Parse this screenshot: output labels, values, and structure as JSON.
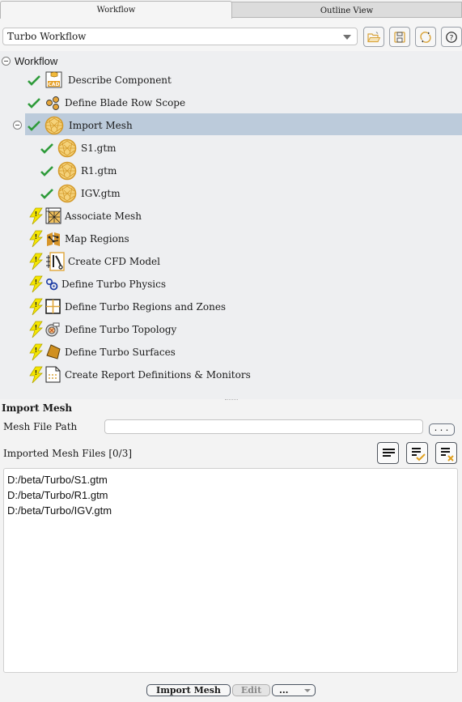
{
  "tabs": [
    {
      "label": "Workflow",
      "active": true
    },
    {
      "label": "Outline View",
      "active": false
    }
  ],
  "toolbar": {
    "workflow_select": "Turbo Workflow",
    "buttons": [
      {
        "icon": "folder-open-icon",
        "tooltip": "Open"
      },
      {
        "icon": "save-icon",
        "tooltip": "Save"
      },
      {
        "icon": "refresh-icon",
        "tooltip": "Refresh"
      },
      {
        "icon": "help-icon",
        "tooltip": "Help"
      }
    ]
  },
  "tree": {
    "root": "Workflow",
    "items": [
      {
        "label": "Describe Component",
        "status": "done",
        "icon": "cad-icon"
      },
      {
        "label": "Define Blade Row Scope",
        "status": "done",
        "icon": "blade-row-icon"
      },
      {
        "label": "Import Mesh",
        "status": "done",
        "icon": "mesh-sphere-icon",
        "selected": true,
        "expanded": true,
        "children": [
          {
            "label": "S1.gtm",
            "status": "done",
            "icon": "mesh-sphere-icon"
          },
          {
            "label": "R1.gtm",
            "status": "done",
            "icon": "mesh-sphere-icon"
          },
          {
            "label": "IGV.gtm",
            "status": "done",
            "icon": "mesh-sphere-icon"
          }
        ]
      },
      {
        "label": "Associate Mesh",
        "status": "pending",
        "icon": "associate-mesh-icon"
      },
      {
        "label": "Map Regions",
        "status": "pending",
        "icon": "map-regions-icon"
      },
      {
        "label": "Create CFD Model",
        "status": "pending",
        "icon": "cfd-model-icon"
      },
      {
        "label": "Define Turbo Physics",
        "status": "pending",
        "icon": "physics-icon"
      },
      {
        "label": "Define Turbo Regions and Zones",
        "status": "pending",
        "icon": "regions-zones-icon"
      },
      {
        "label": "Define Turbo Topology",
        "status": "pending",
        "icon": "topology-icon"
      },
      {
        "label": "Define Turbo Surfaces",
        "status": "pending",
        "icon": "surfaces-icon"
      },
      {
        "label": "Create Report Definitions & Monitors",
        "status": "pending",
        "icon": "report-icon"
      }
    ]
  },
  "panel": {
    "title": "Import Mesh",
    "mesh_file_path_label": "Mesh File Path",
    "mesh_file_path_value": "",
    "browse_label": "...",
    "imported_label": "Imported Mesh Files [0/3]",
    "list_buttons": [
      "list-icon",
      "select-all-icon",
      "clear-list-icon"
    ],
    "files": [
      "D:/beta/Turbo/S1.gtm",
      "D:/beta/Turbo/R1.gtm",
      "D:/beta/Turbo/IGV.gtm"
    ],
    "actions": {
      "import": "Import Mesh",
      "edit": "Edit",
      "more": "..."
    }
  },
  "colors": {
    "selection": "#bccbdb",
    "check": "#2e9b3a",
    "warning": "#f5e600",
    "icon_accent": "#d9a43a"
  }
}
